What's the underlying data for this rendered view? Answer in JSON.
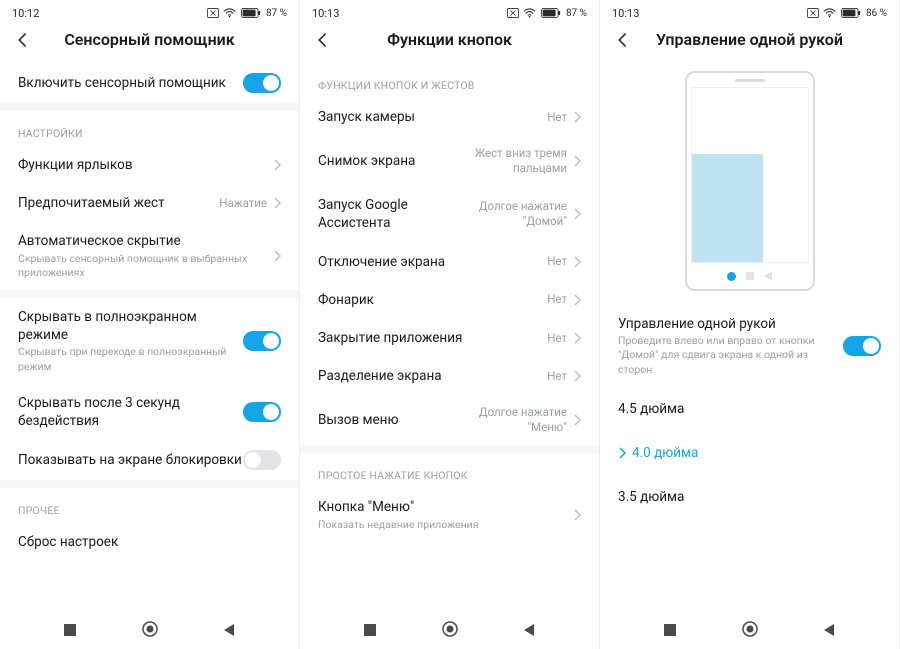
{
  "screens": [
    {
      "time": "10:12",
      "battery": "87",
      "title": "Сенсорный помощник",
      "sections": [
        {
          "header": null,
          "items": [
            {
              "label": "Включить сенсорный помощник",
              "toggle": true
            }
          ]
        },
        {
          "header": "НАСТРОЙКИ",
          "items": [
            {
              "label": "Функции ярлыков",
              "chevron": true
            },
            {
              "label": "Предпочитаемый жест",
              "value": "Нажатие",
              "chevron": true
            },
            {
              "label": "Автоматическое скрытие",
              "sub": "Скрывать сенсорный помощник в выбранных приложениях",
              "chevron": true
            },
            {
              "label": "Скрывать в полноэкранном режиме",
              "sub": "Скрывать при переходе в полноэкранный режим",
              "toggle": true
            },
            {
              "label": "Скрывать после 3 секунд бездействия",
              "toggle": true
            },
            {
              "label": "Показывать на экране блокировки",
              "toggle": false
            }
          ]
        },
        {
          "header": "ПРОЧЕЕ",
          "items": [
            {
              "label": "Сброс настроек"
            }
          ]
        }
      ]
    },
    {
      "time": "10:13",
      "battery": "87",
      "title": "Функции кнопок",
      "sections": [
        {
          "header": "ФУНКЦИИ КНОПОК И ЖЕСТОВ",
          "items": [
            {
              "label": "Запуск камеры",
              "value": "Нет",
              "chevron": true
            },
            {
              "label": "Снимок экрана",
              "value": "Жест вниз тремя пальцами",
              "chevron": true
            },
            {
              "label": "Запуск Google Ассистента",
              "value": "Долгое нажатие \"Домой\"",
              "chevron": true
            },
            {
              "label": "Отключение экрана",
              "value": "Нет",
              "chevron": true
            },
            {
              "label": "Фонарик",
              "value": "Нет",
              "chevron": true
            },
            {
              "label": "Закрытие приложения",
              "value": "Нет",
              "chevron": true
            },
            {
              "label": "Разделение экрана",
              "value": "Нет",
              "chevron": true
            },
            {
              "label": "Вызов меню",
              "value": "Долгое нажатие \"Меню\"",
              "chevron": true
            }
          ]
        },
        {
          "header": "ПРОСТОЕ НАЖАТИЕ КНОПОК",
          "items": [
            {
              "label": "Кнопка \"Меню\"",
              "sub": "Показать недавние приложения",
              "chevron": true
            }
          ]
        }
      ]
    },
    {
      "time": "10:13",
      "battery": "86",
      "title": "Управление одной рукой",
      "one_hand": {
        "label": "Управление одной рукой",
        "sub": "Проведите влево или вправо от кнопки \"Домой\" для сдвига экрана к одной из сторон",
        "toggle": true
      },
      "sizes": [
        {
          "label": "4.5 дюйма",
          "active": false
        },
        {
          "label": "4.0 дюйма",
          "active": true
        },
        {
          "label": "3.5 дюйма",
          "active": false
        }
      ]
    }
  ]
}
